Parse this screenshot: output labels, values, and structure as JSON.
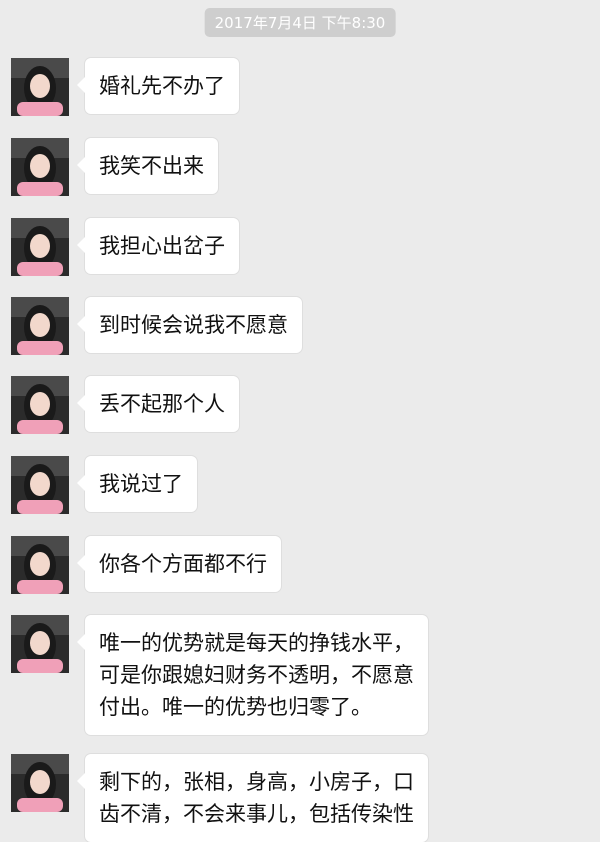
{
  "timestamp": "2017年7月4日 下午8:30",
  "messages": [
    {
      "text": "婚礼先不办了"
    },
    {
      "text": "我笑不出来"
    },
    {
      "text": "我担心出岔子"
    },
    {
      "text": "到时候会说我不愿意"
    },
    {
      "text": "丢不起那个人"
    },
    {
      "text": "我说过了"
    },
    {
      "text": "你各个方面都不行"
    },
    {
      "lines": [
        "唯一的优势就是每天的挣钱水平，",
        "可是你跟媳妇财务不透明，不愿意",
        "付出。唯一的优势也归零了。"
      ]
    },
    {
      "lines": [
        "剩下的，张相，身高，小房子，口",
        "齿不清，不会来事儿，包括传染性"
      ]
    }
  ],
  "colors": {
    "background": "#ebebeb",
    "bubble": "#ffffff",
    "timestamp_pill": "#cecece"
  },
  "icons": {
    "avatar": "contact-avatar-photo"
  }
}
